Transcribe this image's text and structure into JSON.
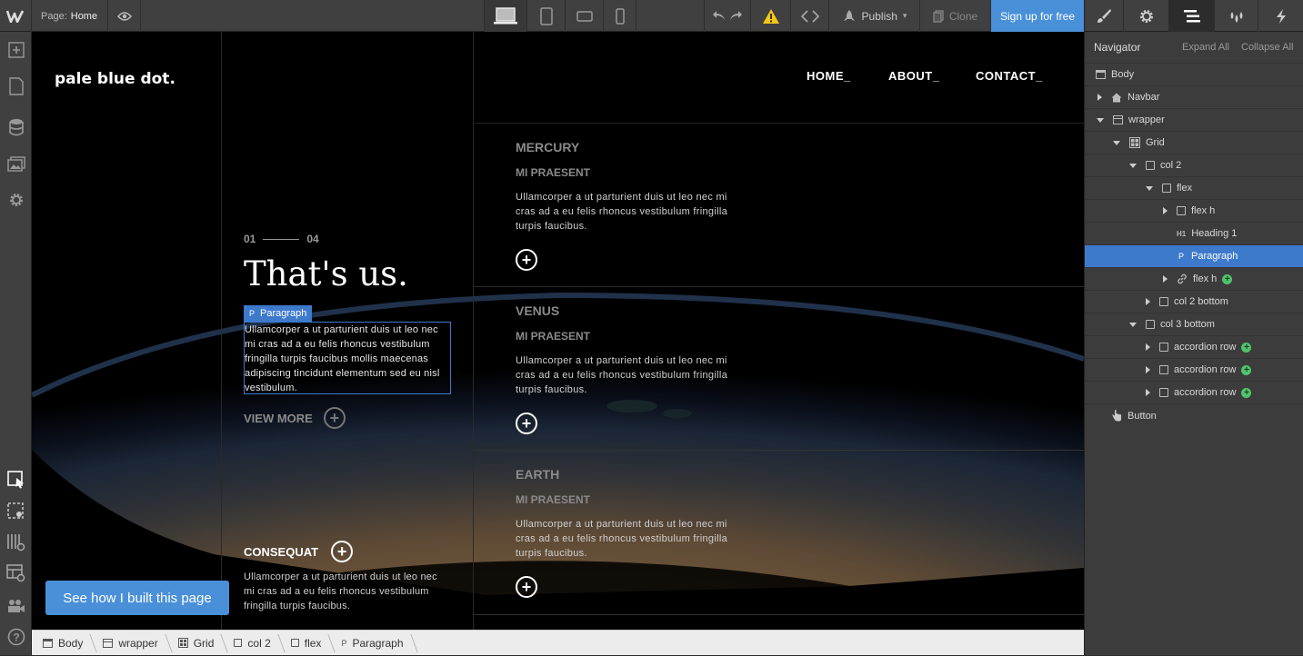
{
  "topbar": {
    "page_label": "Page:",
    "page_name": "Home",
    "publish_label": "Publish",
    "clone_label": "Clone",
    "signup_label": "Sign up for free"
  },
  "navigator": {
    "title": "Navigator",
    "expand_all": "Expand All",
    "collapse_all": "Collapse All",
    "items": [
      {
        "label": "Body"
      },
      {
        "label": "Navbar"
      },
      {
        "label": "wrapper"
      },
      {
        "label": "Grid"
      },
      {
        "label": "col 2"
      },
      {
        "label": "flex"
      },
      {
        "label": "flex h"
      },
      {
        "label": "Heading 1"
      },
      {
        "label": "Paragraph"
      },
      {
        "label": "flex h"
      },
      {
        "label": "col 2 bottom"
      },
      {
        "label": "col 3 bottom"
      },
      {
        "label": "accordion row"
      },
      {
        "label": "accordion row"
      },
      {
        "label": "accordion row"
      },
      {
        "label": "Button"
      }
    ]
  },
  "site": {
    "logo": "pale blue dot.",
    "nav": [
      "HOME_",
      "ABOUT_",
      "CONTACT_"
    ],
    "counter_start": "01",
    "counter_end": "04",
    "heading": "That's us.",
    "selected_tag": "Paragraph",
    "intro": "Ullamcorper a ut parturient duis ut leo nec mi cras ad a eu felis rhoncus vestibulum fringilla turpis faucibus mollis maecenas adipiscing tincidunt elementum sed eu nisl vestibulum.",
    "view_more": "VIEW MORE",
    "consequat_title": "CONSEQUAT",
    "consequat_text": "Ullamcorper a ut parturient duis ut leo nec mi cras ad a eu felis rhoncus vestibulum fringilla turpis faucibus.",
    "see_how": "See how I built this page",
    "planets": [
      {
        "name": "MERCURY",
        "sub": "MI PRAESENT",
        "text": "Ullamcorper a ut parturient duis ut leo nec mi cras ad a eu felis rhoncus vestibulum fringilla turpis faucibus."
      },
      {
        "name": "VENUS",
        "sub": "MI PRAESENT",
        "text": "Ullamcorper a ut parturient duis ut leo nec mi cras ad a eu felis rhoncus vestibulum fringilla turpis faucibus."
      },
      {
        "name": "EARTH",
        "sub": "MI PRAESENT",
        "text": "Ullamcorper a ut parturient duis ut leo nec mi cras ad a eu felis rhoncus vestibulum fringilla turpis faucibus."
      }
    ]
  },
  "breadcrumb": [
    "Body",
    "wrapper",
    "Grid",
    "col 2",
    "flex",
    "Paragraph"
  ],
  "colors": {
    "accent": "#3d7acc",
    "signup": "#4a90d9",
    "add_green": "#4fc46b",
    "warning": "#f5c518"
  }
}
